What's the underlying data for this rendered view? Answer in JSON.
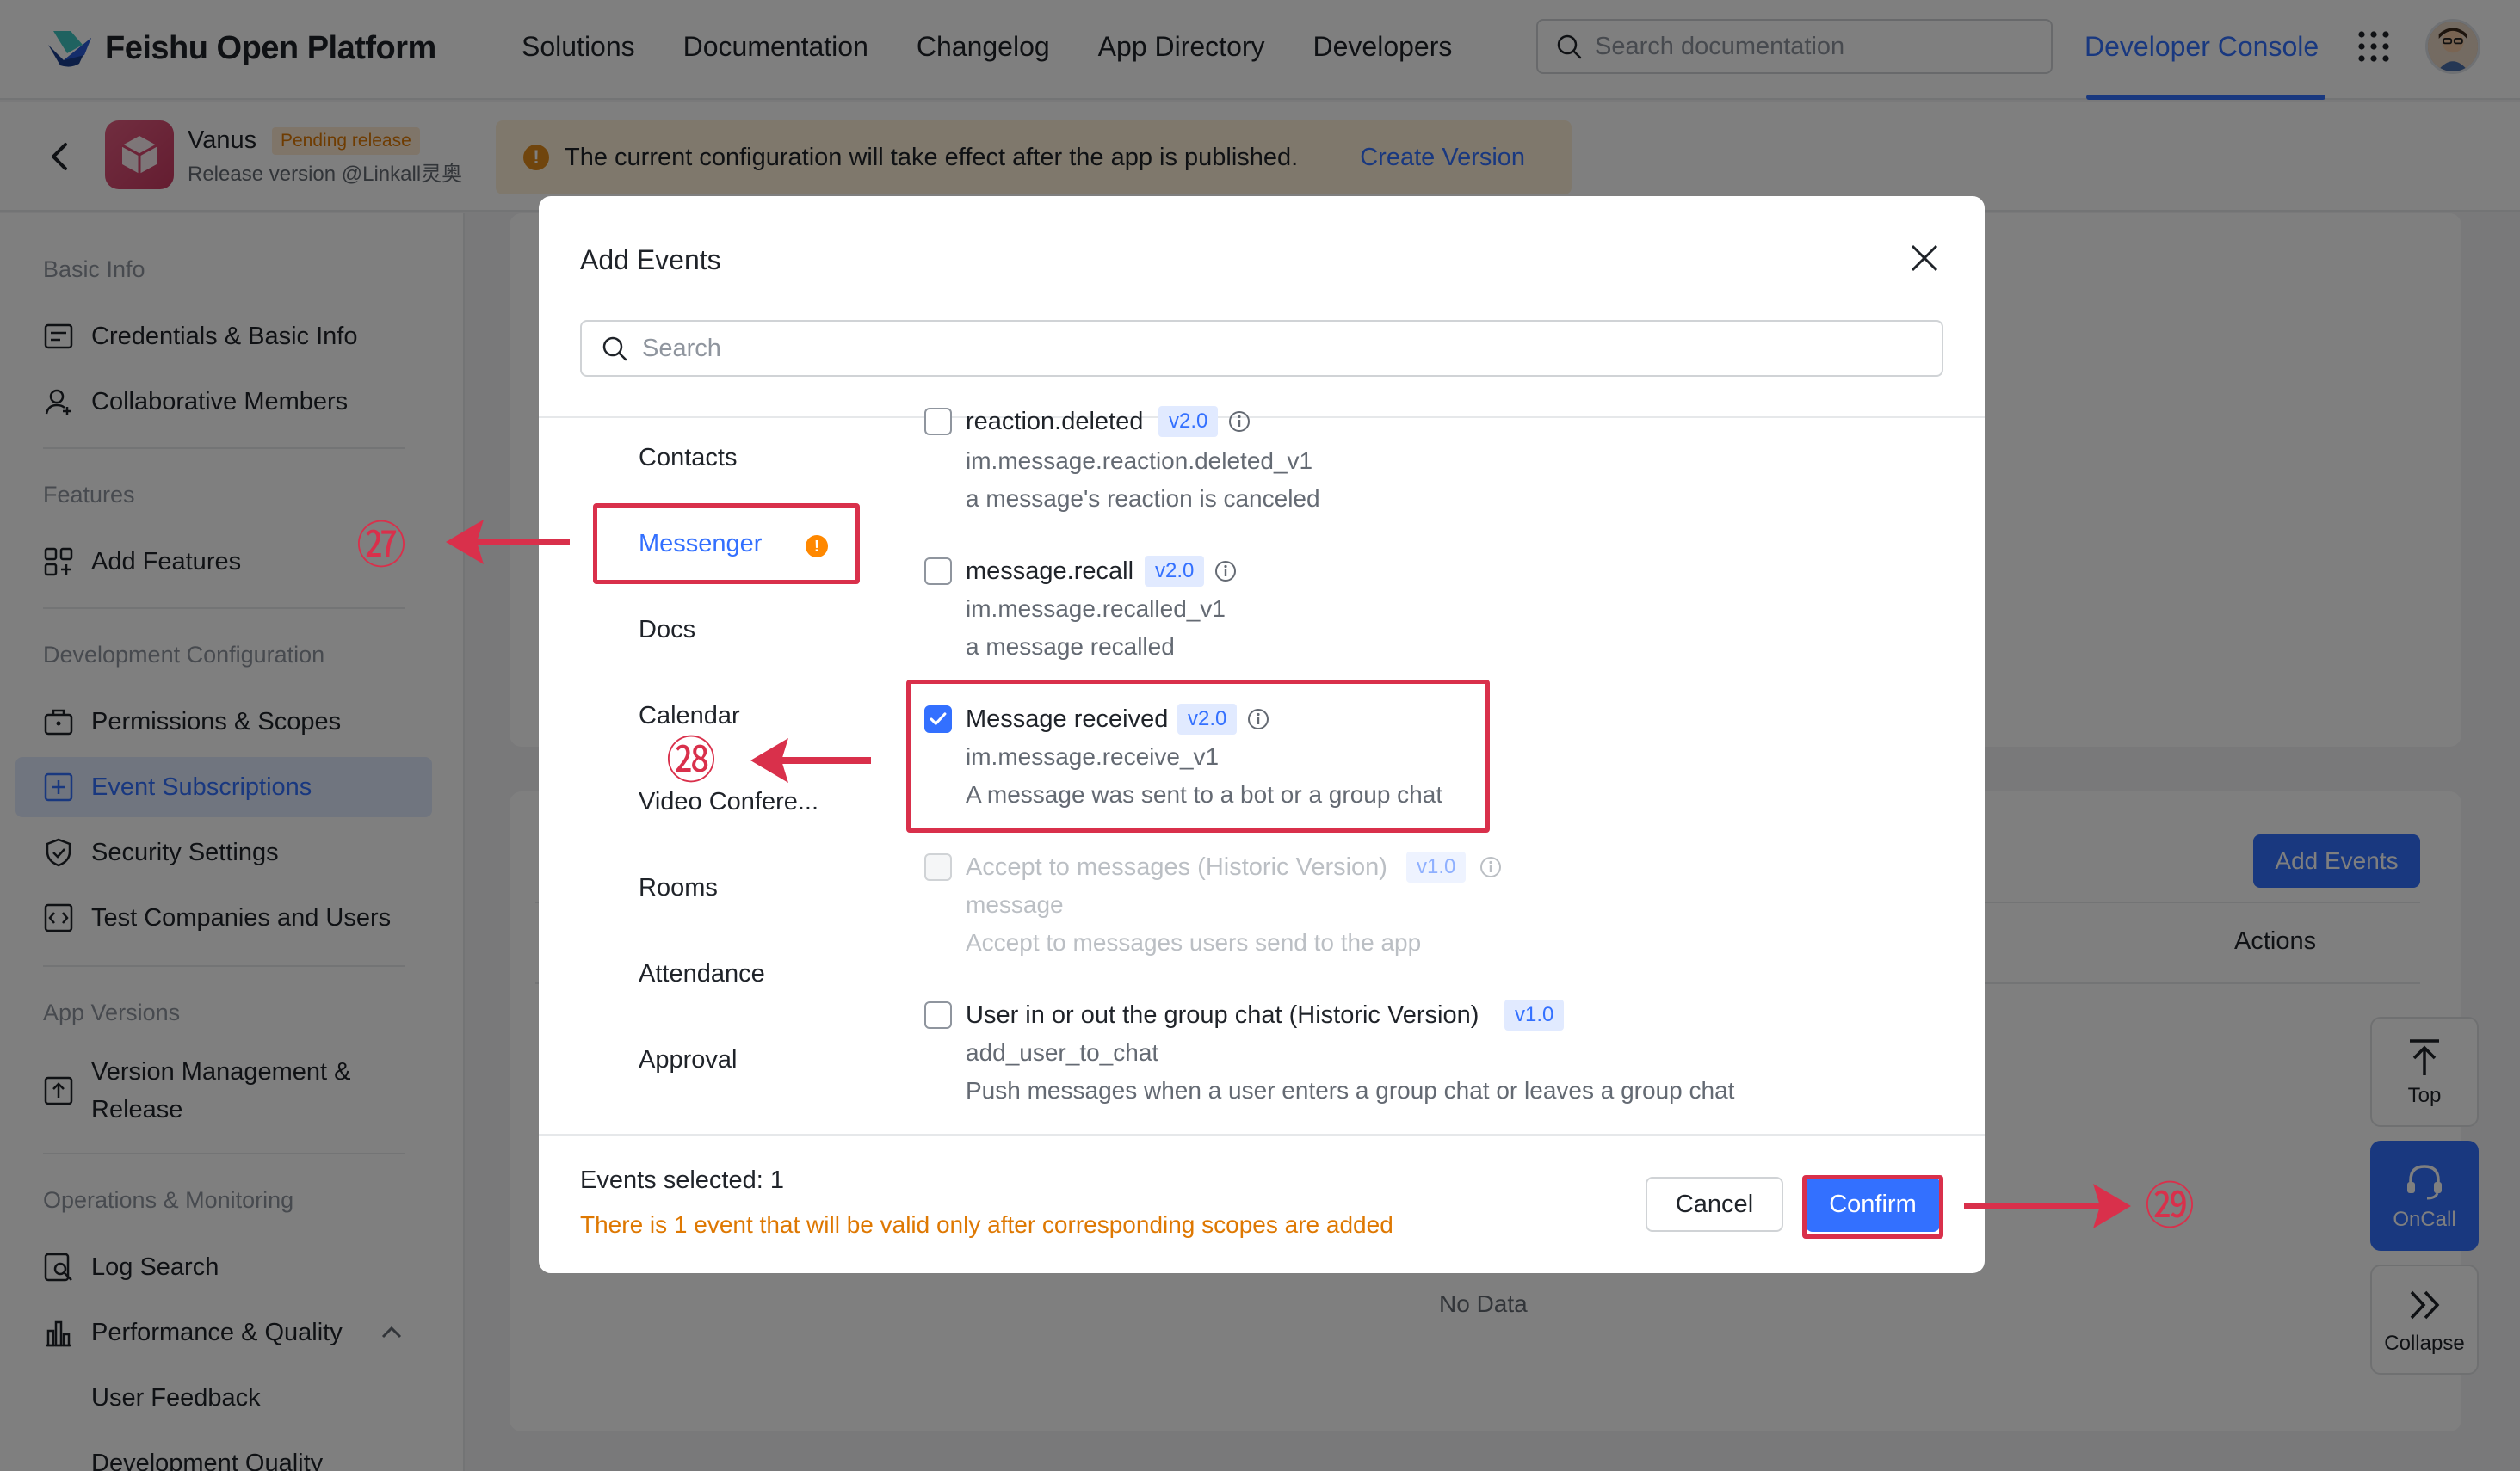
{
  "topnav": {
    "brand": "Feishu Open Platform",
    "links": [
      "Solutions",
      "Documentation",
      "Changelog",
      "App Directory",
      "Developers"
    ],
    "search_placeholder": "Search documentation",
    "developer_console": "Developer Console"
  },
  "app_header": {
    "app_name": "Vanus",
    "status_badge": "Pending release",
    "release_version": "Release version @Linkall灵奥",
    "notice_text": "The current configuration will take effect after the app is published.",
    "notice_link": "Create Version"
  },
  "sidebar": {
    "sections": [
      {
        "title": "Basic Info",
        "items": [
          "Credentials & Basic Info",
          "Collaborative Members"
        ]
      },
      {
        "title": "Features",
        "items": [
          "Add Features"
        ]
      },
      {
        "title": "Development Configuration",
        "items": [
          "Permissions & Scopes",
          "Event Subscriptions",
          "Security Settings",
          "Test Companies and Users"
        ]
      },
      {
        "title": "App Versions",
        "items": [
          "Version Management & Release"
        ]
      },
      {
        "title": "Operations & Monitoring",
        "items": [
          "Log Search",
          "Performance & Quality",
          "User Feedback",
          "Development Quality"
        ]
      }
    ],
    "active_item": "Event Subscriptions"
  },
  "main": {
    "add_events_button": "Add Events",
    "actions_column": "Actions",
    "no_data": "No Data"
  },
  "float_buttons": [
    "Top",
    "OnCall",
    "Collapse"
  ],
  "modal": {
    "title": "Add Events",
    "search_placeholder": "Search",
    "categories": [
      "Contacts",
      "Messenger",
      "Docs",
      "Calendar",
      "Video Confere...",
      "Rooms",
      "Attendance",
      "Approval"
    ],
    "active_category": "Messenger",
    "events": [
      {
        "name": "reaction.deleted",
        "version": "v2.0",
        "code": "im.message.reaction.deleted_v1",
        "description": "a message's reaction is canceled",
        "checked": false,
        "disabled": false
      },
      {
        "name": "message.recall",
        "version": "v2.0",
        "code": "im.message.recalled_v1",
        "description": "a message recalled",
        "checked": false,
        "disabled": false
      },
      {
        "name": "Message received",
        "version": "v2.0",
        "code": "im.message.receive_v1",
        "description": "A message was sent to a bot or a group chat",
        "checked": true,
        "disabled": false
      },
      {
        "name": "Accept to messages (Historic Version)",
        "version": "v1.0",
        "code": "message",
        "description": "Accept to messages users send to the app",
        "checked": false,
        "disabled": true
      },
      {
        "name": "User in or out the group chat (Historic Version)",
        "version": "v1.0",
        "code": "add_user_to_chat",
        "description": "Push messages when a user enters a group chat or leaves a group chat",
        "checked": false,
        "disabled": false
      }
    ],
    "selected_count": "Events selected: 1",
    "scope_warning": "There is 1 event that will be valid only after corresponding scopes are added",
    "cancel_label": "Cancel",
    "confirm_label": "Confirm"
  },
  "annotations": [
    "㉗",
    "㉘",
    "㉙"
  ],
  "colors": {
    "accent": "#3370ff",
    "annotation": "#d9304b",
    "warning": "#de7802"
  }
}
